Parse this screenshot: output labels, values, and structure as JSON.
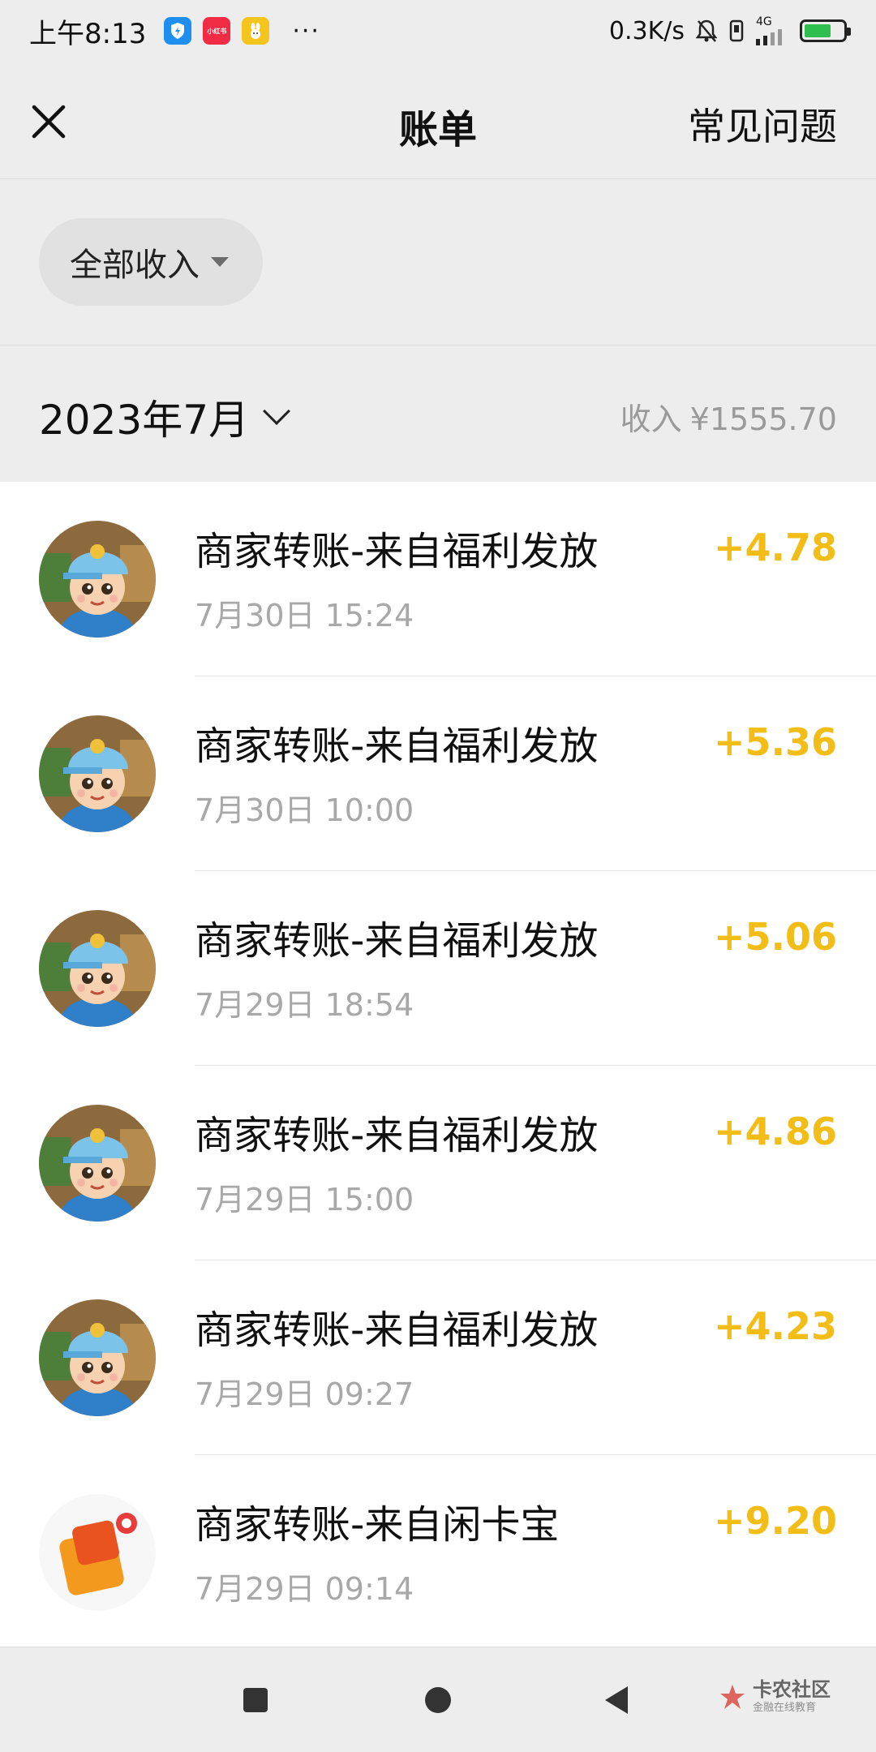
{
  "status_bar": {
    "time": "上午8:13",
    "apps": [
      {
        "name": "shield-app",
        "color": "#1e8ff0"
      },
      {
        "name": "xiaohongshu-app",
        "label": "小红书",
        "color": "#ef2c44"
      },
      {
        "name": "rabbit-app",
        "color": "#f5c51e"
      }
    ],
    "more": "···",
    "net_speed": "0.3K/s",
    "network": "4G"
  },
  "nav": {
    "title": "账单",
    "faq_label": "常见问题"
  },
  "filter": {
    "label": "全部收入"
  },
  "month": {
    "label": "2023年7月",
    "summary_label": "收入",
    "summary_value": "¥1555.70"
  },
  "transactions": [
    {
      "title": "商家转账-来自福利发放",
      "time": "7月30日 15:24",
      "amount": "+4.78",
      "avatar": "cartoon-boy"
    },
    {
      "title": "商家转账-来自福利发放",
      "time": "7月30日 10:00",
      "amount": "+5.36",
      "avatar": "cartoon-boy"
    },
    {
      "title": "商家转账-来自福利发放",
      "time": "7月29日 18:54",
      "amount": "+5.06",
      "avatar": "cartoon-boy"
    },
    {
      "title": "商家转账-来自福利发放",
      "time": "7月29日 15:00",
      "amount": "+4.86",
      "avatar": "cartoon-boy"
    },
    {
      "title": "商家转账-来自福利发放",
      "time": "7月29日 09:27",
      "amount": "+4.23",
      "avatar": "cartoon-boy"
    },
    {
      "title": "商家转账-来自闲卡宝",
      "time": "7月29日 09:14",
      "amount": "+9.20",
      "avatar": "wallet-logo"
    }
  ],
  "watermark": {
    "main": "卡农社区",
    "sub": "金融在线教育"
  },
  "colors": {
    "income": "#f2bd16",
    "background": "#ededed",
    "list_bg": "#ffffff"
  }
}
